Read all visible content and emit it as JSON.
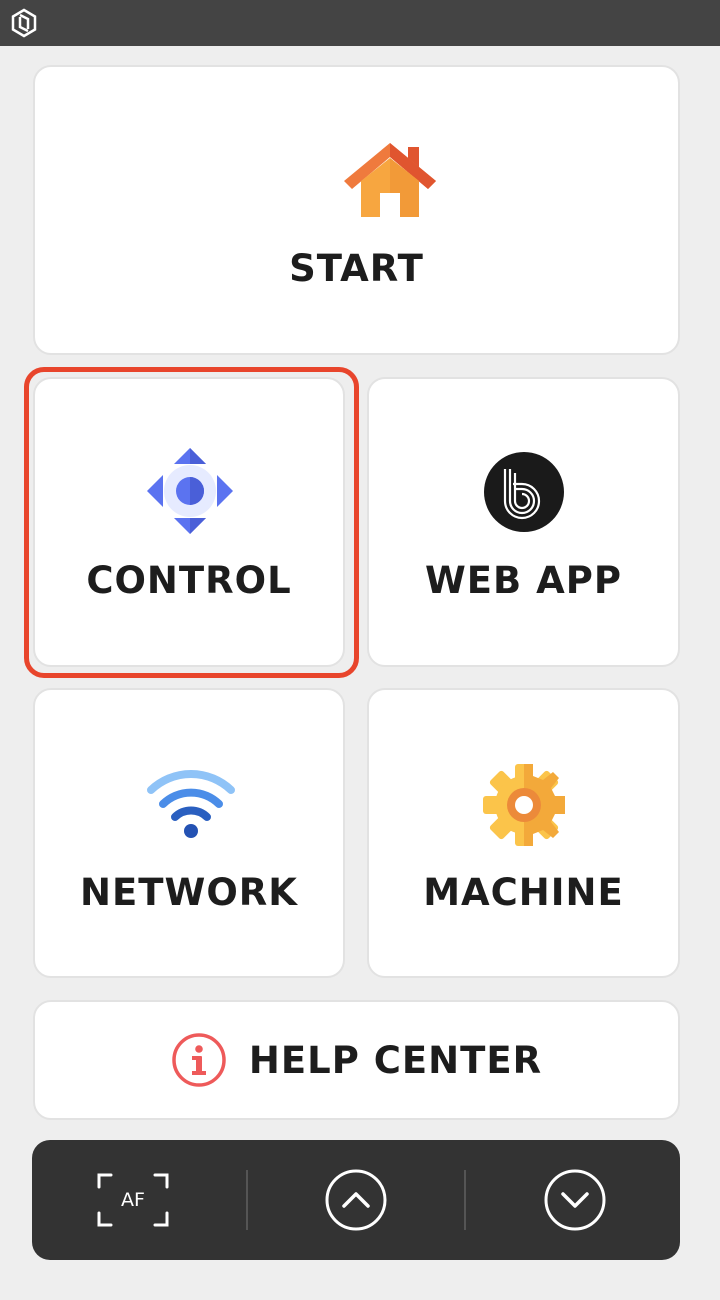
{
  "colors": {
    "accent_highlight": "#e8452c",
    "top_bar": "#444444",
    "bottom_bar": "#333333",
    "card_bg": "#ffffff",
    "page_bg": "#eeeeee"
  },
  "top_bar": {
    "logo_icon": "app-logo-icon"
  },
  "menu": {
    "start": {
      "label": "START",
      "icon": "house-icon"
    },
    "control": {
      "label": "CONTROL",
      "icon": "directional-pad-icon",
      "selected": true
    },
    "web_app": {
      "label": "WEB APP",
      "icon": "web-app-logo-icon"
    },
    "network": {
      "label": "NETWORK",
      "icon": "wifi-icon"
    },
    "machine": {
      "label": "MACHINE",
      "icon": "gear-icon"
    },
    "help_center": {
      "label": "HELP CENTER",
      "icon": "info-icon"
    }
  },
  "bottom_bar": {
    "autofocus": {
      "label": "AF",
      "icon": "autofocus-icon"
    },
    "scroll_up": {
      "icon": "chevron-up-circle-icon"
    },
    "scroll_down": {
      "icon": "chevron-down-circle-icon"
    }
  }
}
